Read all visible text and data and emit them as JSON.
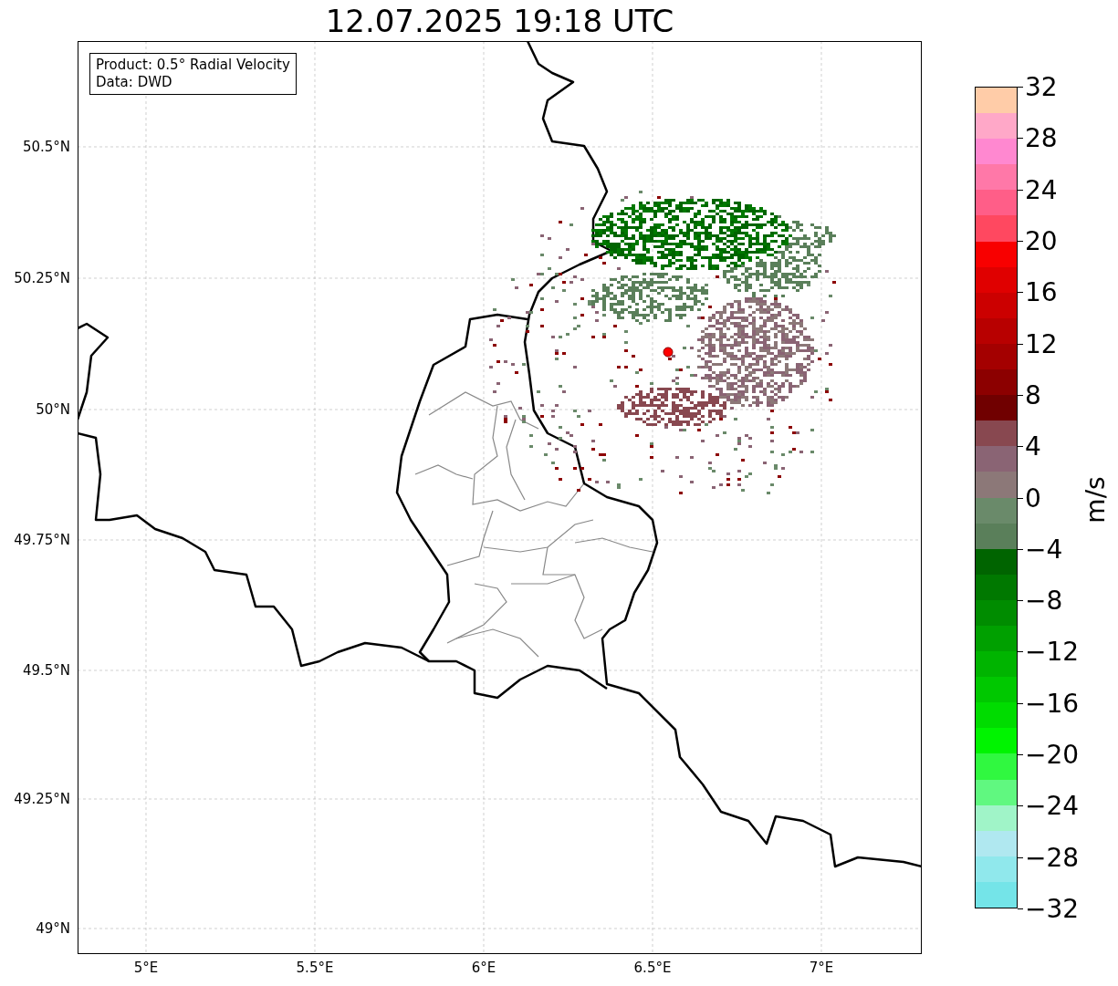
{
  "title": "12.07.2025 19:18 UTC",
  "info_box": {
    "lines": [
      "Product: 0.5° Radial Velocity",
      "Data: DWD"
    ]
  },
  "map": {
    "latitude_labels": [
      "50.5°N",
      "50.25°N",
      "50°N",
      "49.75°N",
      "49.5°N",
      "49.25°N",
      "49°N"
    ],
    "longitude_labels": [
      "5°E",
      "5.5°E",
      "6°E",
      "6.5°E",
      "7°E"
    ]
  },
  "colorbar": {
    "label": "m/s",
    "ticks": [
      "32",
      "28",
      "24",
      "20",
      "16",
      "12",
      "8",
      "4",
      "0",
      "−4",
      "−8",
      "−12",
      "−16",
      "−20",
      "−24",
      "−28",
      "−32"
    ],
    "segments": [
      {
        "color": "#ffcca8"
      },
      {
        "color": "#ffa8c8"
      },
      {
        "color": "#ff88d0"
      },
      {
        "color": "#ff78a8"
      },
      {
        "color": "#ff5e88"
      },
      {
        "color": "#ff4860"
      },
      {
        "color": "#f80000"
      },
      {
        "color": "#e00000"
      },
      {
        "color": "#cc0000"
      },
      {
        "color": "#b80000"
      },
      {
        "color": "#a40000"
      },
      {
        "color": "#8c0000"
      },
      {
        "color": "#700000"
      },
      {
        "color": "#884850"
      },
      {
        "color": "#8a6474"
      },
      {
        "color": "#8c7878"
      },
      {
        "color": "#6a8a6a"
      },
      {
        "color": "#5a7f5a"
      },
      {
        "color": "#006400"
      },
      {
        "color": "#007800"
      },
      {
        "color": "#008c00"
      },
      {
        "color": "#00a000"
      },
      {
        "color": "#00b400"
      },
      {
        "color": "#00c800"
      },
      {
        "color": "#00dc00"
      },
      {
        "color": "#00f400"
      },
      {
        "color": "#30f840"
      },
      {
        "color": "#60f880"
      },
      {
        "color": "#a0f4c8"
      },
      {
        "color": "#b0e8f0"
      },
      {
        "color": "#90e8ec"
      },
      {
        "color": "#74e4e8"
      }
    ]
  }
}
